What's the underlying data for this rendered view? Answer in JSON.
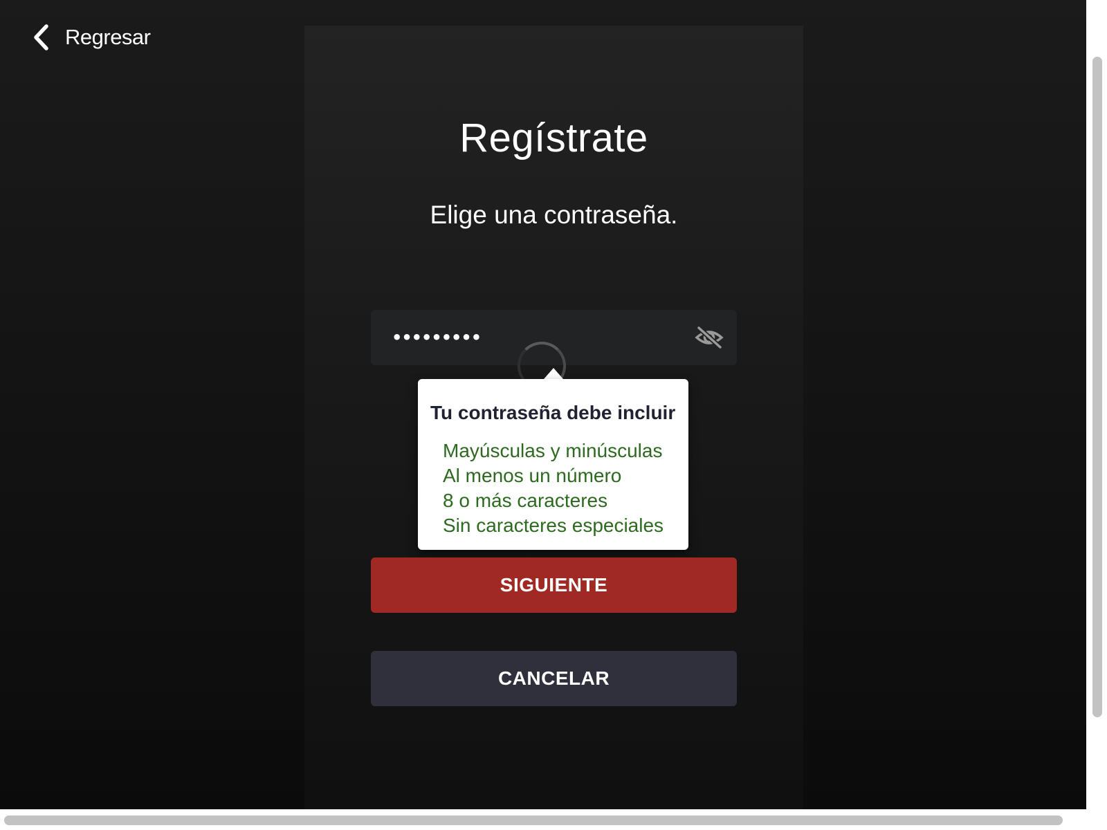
{
  "nav": {
    "back_label": "Regresar",
    "back_icon": "chevron-left-icon"
  },
  "page": {
    "title": "Regístrate",
    "subtitle": "Elige una contraseña."
  },
  "password": {
    "value": "•••••••••",
    "toggle_icon": "eye-slash-icon"
  },
  "tooltip": {
    "title": "Tu contraseña debe incluir",
    "requirements": [
      "Mayúsculas y minúsculas",
      "Al menos un número",
      "8 o más caracteres",
      "Sin caracteres especiales"
    ]
  },
  "buttons": {
    "next_label": "SIGUIENTE",
    "cancel_label": "CANCELAR"
  },
  "colors": {
    "primary": "#a02a23",
    "secondary": "#2f303b",
    "requirement_met": "#2d6a1f",
    "background": "#141414"
  }
}
